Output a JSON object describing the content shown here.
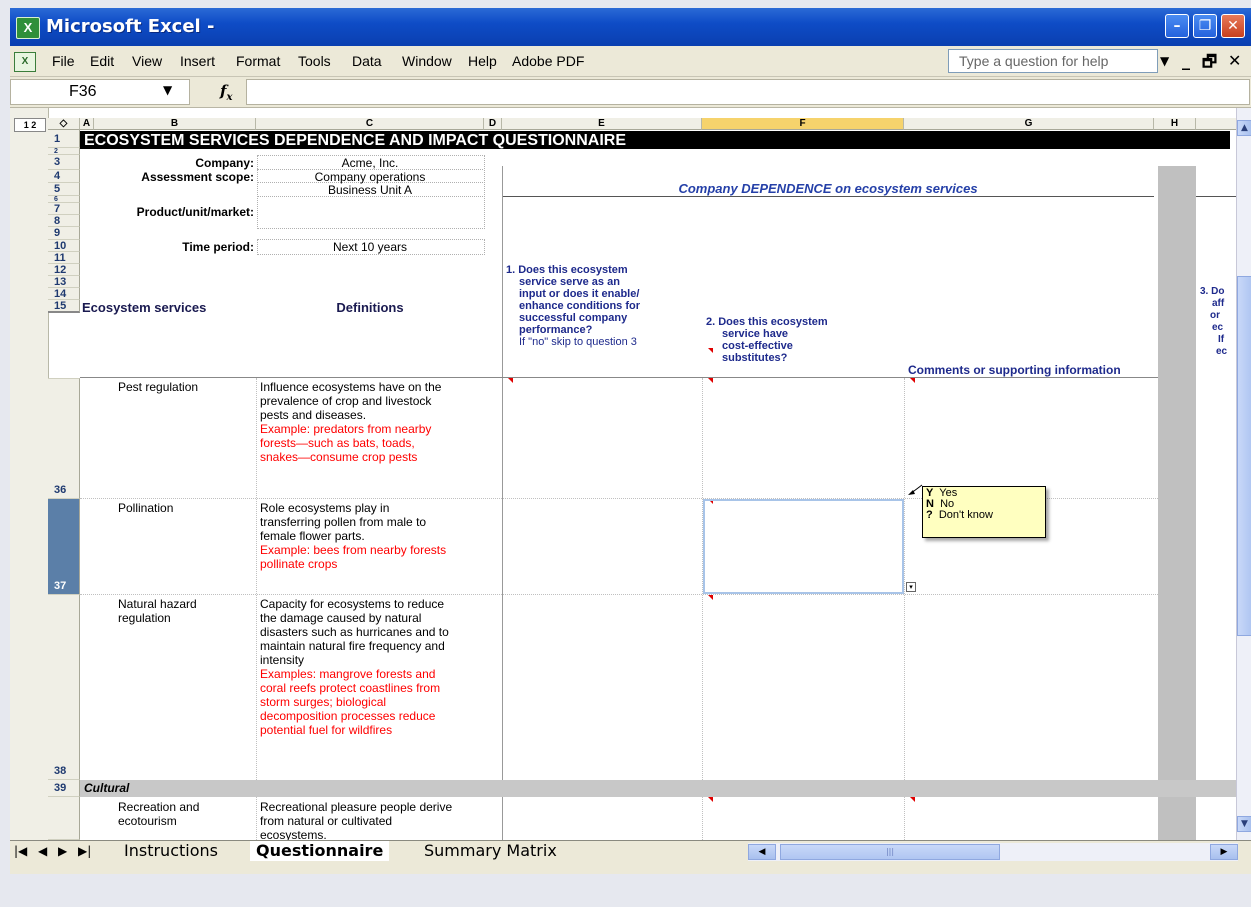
{
  "window": {
    "title": "Microsoft Excel -",
    "app_icon": "excel-icon"
  },
  "menu": {
    "items": [
      "File",
      "Edit",
      "View",
      "Insert",
      "Format",
      "Tools",
      "Data",
      "Window",
      "Help",
      "Adobe PDF"
    ],
    "help_placeholder": "Type a question for help"
  },
  "formula_bar": {
    "cell_ref": "F36",
    "fx": "fx",
    "content": ""
  },
  "outline_levels": "1 2",
  "columns": [
    "A",
    "B",
    "C",
    "D",
    "E",
    "F",
    "G",
    "H"
  ],
  "selected_column": "F",
  "sheet": {
    "title": "ECOSYSTEM SERVICES DEPENDENCE AND IMPACT QUESTIONNAIRE",
    "company_label": "Company:",
    "company_value": "Acme, Inc.",
    "scope_label": "Assessment scope:",
    "scope_value": "Company operations",
    "product_label": "Product/unit/market:",
    "product_value": "Business Unit A",
    "period_label": "Time period:",
    "period_value": "Next 10 years",
    "section_header": "Company DEPENDENCE on ecosystem services",
    "q1": [
      "1.  Does this ecosystem",
      "service serve as an",
      "input or does it enable/",
      "enhance conditions for",
      "successful company",
      "performance?"
    ],
    "q1_note": "If \"no\" skip to question 3",
    "q2": [
      "2.  Does this ecosystem",
      "service have",
      "cost-effective",
      "substitutes?"
    ],
    "comments_header": "Comments or supporting information",
    "q3_partial": [
      "3. Do",
      "aff",
      "or",
      "ec",
      "If",
      "ec"
    ],
    "col_services": "Ecosystem services",
    "col_definitions": "Definitions",
    "cultural": "Cultural"
  },
  "rows_visible": [
    "1",
    "2",
    "3",
    "4",
    "5",
    "6",
    "7",
    "8",
    "9",
    "10",
    "11",
    "12",
    "13",
    "14",
    "15",
    "36",
    "37",
    "38",
    "39"
  ],
  "services": [
    {
      "row": "36",
      "name": [
        "Pest regulation"
      ],
      "definition": [
        "Influence ecosystems have on the",
        "prevalence of crop and livestock",
        "pests and diseases."
      ],
      "example": [
        "Example: predators from nearby",
        "forests—such as bats, toads,",
        "snakes—consume crop pests"
      ]
    },
    {
      "row": "37",
      "name": [
        "Pollination"
      ],
      "definition": [
        "Role ecosystems play in",
        "transferring pollen from male to",
        "female flower parts."
      ],
      "example": [
        "Example: bees from nearby forests",
        "pollinate crops"
      ]
    },
    {
      "row": "38",
      "name": [
        "Natural hazard",
        "regulation"
      ],
      "definition": [
        "Capacity for ecosystems to reduce",
        "the damage caused by natural",
        "disasters such as hurricanes and to",
        "maintain natural fire frequency and",
        "intensity"
      ],
      "example": [
        "Examples: mangrove forests and",
        "coral reefs protect coastlines from",
        "storm surges; biological",
        "decomposition processes reduce",
        "potential fuel for wildfires"
      ]
    },
    {
      "row": "",
      "name": [
        "Recreation and",
        "ecotourism"
      ],
      "definition": [
        "Recreational pleasure people derive",
        "from natural or cultivated",
        "ecosystems."
      ],
      "example": []
    }
  ],
  "tooltip": {
    "options": [
      {
        "key": "Y",
        "label": "Yes"
      },
      {
        "key": "N",
        "label": "No"
      },
      {
        "key": "?",
        "label": "Don't know"
      }
    ]
  },
  "tabs": [
    "Instructions",
    "Questionnaire",
    "Summary Matrix"
  ],
  "active_tab": "Questionnaire",
  "colors": {
    "title_bg": "#000000",
    "header_blue": "#2540a8",
    "example_red": "#ff0000",
    "selected_col": "#f6d36c",
    "gray_col": "#c0c0c0"
  }
}
